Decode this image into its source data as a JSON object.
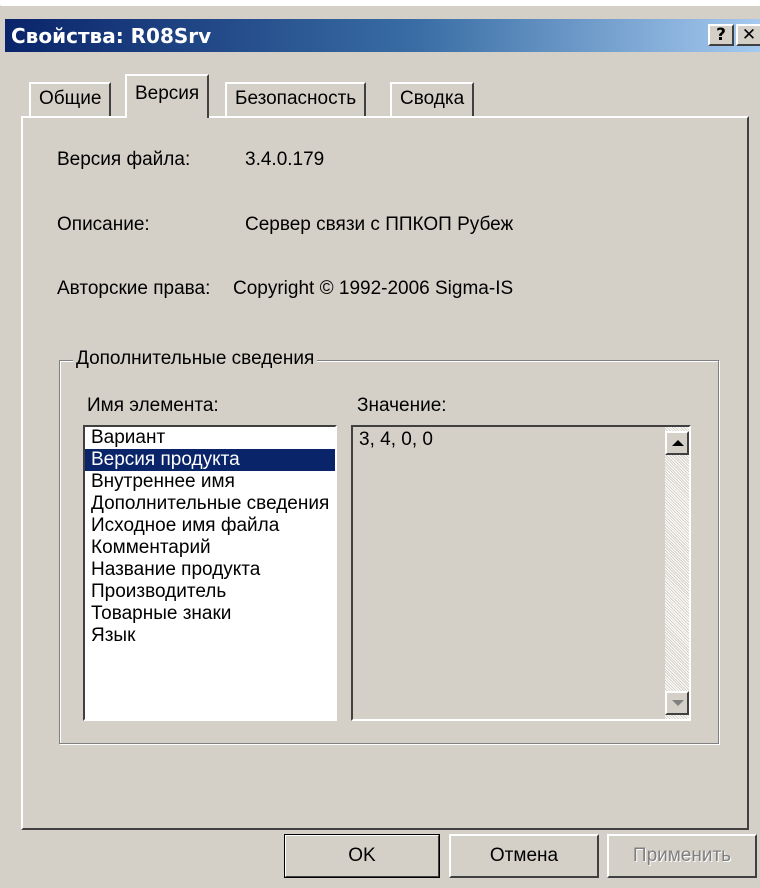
{
  "window": {
    "title": "Свойства: R08Srv",
    "help_label": "?",
    "close_label": "✕"
  },
  "tabs": [
    {
      "label": "Общие"
    },
    {
      "label": "Версия"
    },
    {
      "label": "Безопасность"
    },
    {
      "label": "Сводка"
    }
  ],
  "info": {
    "file_version_label": "Версия файла:",
    "file_version_value": "3.4.0.179",
    "description_label": "Описание:",
    "description_value": "Сервер связи с ППКОП  Рубеж",
    "copyright_label": "Авторские права:",
    "copyright_value": "Copyright © 1992-2006 Sigma-IS"
  },
  "details": {
    "group_title": "Дополнительные сведения",
    "item_name_header": "Имя элемента:",
    "value_header": "Значение:",
    "items": [
      "Вариант",
      "Версия продукта",
      "Внутреннее имя",
      "Дополнительные сведения",
      "Исходное имя файла",
      "Комментарий",
      "Название продукта",
      "Производитель",
      "Товарные знаки",
      "Язык"
    ],
    "selected_index": 1,
    "value": "3, 4, 0, 0"
  },
  "buttons": {
    "ok": "OK",
    "cancel": "Отмена",
    "apply": "Применить"
  }
}
